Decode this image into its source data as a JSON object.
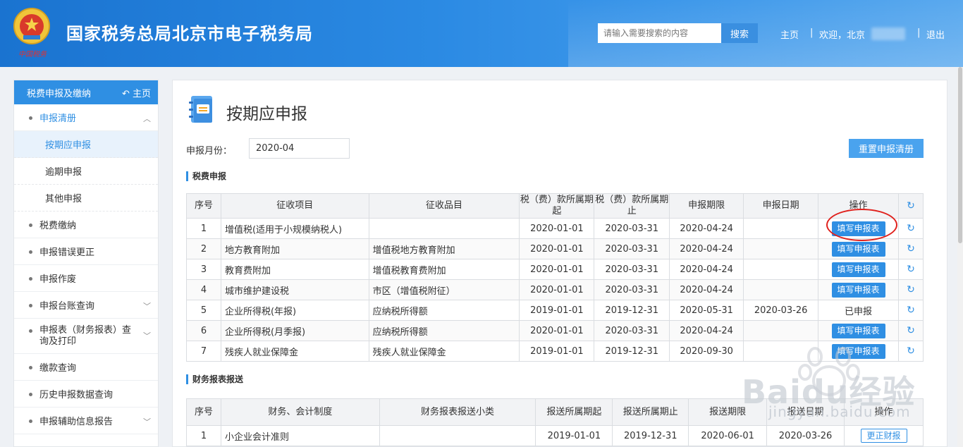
{
  "header": {
    "emblem_caption": "中国税务",
    "title": "国家税务总局北京市电子税务局",
    "search_placeholder": "请输入需要搜索的内容",
    "search_button": "搜索",
    "nav_home": "主页",
    "separator": "|",
    "welcome": "欢迎，北京",
    "logout": "退出"
  },
  "sidebar": {
    "header_label": "税费申报及缴纳",
    "home_label": "主页",
    "items": [
      {
        "label": "申报清册"
      },
      {
        "label": "按期应申报"
      },
      {
        "label": "逾期申报"
      },
      {
        "label": "其他申报"
      },
      {
        "label": "税费缴纳"
      },
      {
        "label": "申报错误更正"
      },
      {
        "label": "申报作废"
      },
      {
        "label": "申报台账查询"
      },
      {
        "label": "申报表（财务报表）查询及打印"
      },
      {
        "label": "缴款查询"
      },
      {
        "label": "历史申报数据查询"
      },
      {
        "label": "申报辅助信息报告"
      }
    ]
  },
  "main": {
    "page_title": "按期应申报",
    "month_label": "申报月份：",
    "month_value": "2020-04",
    "reset_button": "重置申报清册",
    "section1_title": "税费申报",
    "section2_title": "财务报表报送",
    "table1": {
      "headers": [
        "序号",
        "征收项目",
        "征收品目",
        "税（费）款所属期起",
        "税（费）款所属期止",
        "申报期限",
        "申报日期",
        "操作"
      ],
      "action_label": "填写申报表",
      "done_label": "已申报",
      "rows": [
        {
          "no": "1",
          "item": "增值税(适用于小规模纳税人)",
          "sub": "",
          "start": "2020-01-01",
          "end": "2020-03-31",
          "deadline": "2020-04-24",
          "date": "",
          "done": false
        },
        {
          "no": "2",
          "item": "地方教育附加",
          "sub": "增值税地方教育附加",
          "start": "2020-01-01",
          "end": "2020-03-31",
          "deadline": "2020-04-24",
          "date": "",
          "done": false
        },
        {
          "no": "3",
          "item": "教育费附加",
          "sub": "增值税教育费附加",
          "start": "2020-01-01",
          "end": "2020-03-31",
          "deadline": "2020-04-24",
          "date": "",
          "done": false
        },
        {
          "no": "4",
          "item": "城市维护建设税",
          "sub": "市区（增值税附征）",
          "start": "2020-01-01",
          "end": "2020-03-31",
          "deadline": "2020-04-24",
          "date": "",
          "done": false
        },
        {
          "no": "5",
          "item": "企业所得税(年报)",
          "sub": "应纳税所得额",
          "start": "2019-01-01",
          "end": "2019-12-31",
          "deadline": "2020-05-31",
          "date": "2020-03-26",
          "done": true
        },
        {
          "no": "6",
          "item": "企业所得税(月季报)",
          "sub": "应纳税所得额",
          "start": "2020-01-01",
          "end": "2020-03-31",
          "deadline": "2020-04-24",
          "date": "",
          "done": false
        },
        {
          "no": "7",
          "item": "残疾人就业保障金",
          "sub": "残疾人就业保障金",
          "start": "2019-01-01",
          "end": "2019-12-31",
          "deadline": "2020-09-30",
          "date": "",
          "done": false
        }
      ]
    },
    "table2": {
      "headers": [
        "序号",
        "财务、会计制度",
        "财务报表报送小类",
        "报送所属期起",
        "报送所属期止",
        "报送期限",
        "报送日期",
        "操作"
      ],
      "rows": [
        {
          "no": "1",
          "system": "小企业会计准则",
          "category": "",
          "start": "2019-01-01",
          "end": "2019-12-31",
          "deadline": "2020-06-01",
          "date": "2020-03-26",
          "action": "更正财报"
        }
      ]
    }
  },
  "watermark": {
    "brand": "Baidu经验",
    "url": "jingyan.baidu.com"
  },
  "colors": {
    "header_blue": "#1a73d0",
    "accent": "#2f8fe3",
    "highlight_circle": "#e0201c"
  }
}
